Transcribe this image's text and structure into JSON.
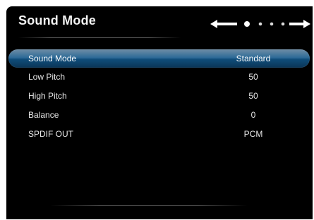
{
  "header": {
    "title": "Sound Mode"
  },
  "pager": {
    "left_icon": "arrow-left-icon",
    "right_icon": "arrow-right-icon",
    "dots": 4,
    "active_dot": 1
  },
  "menu": {
    "items": [
      {
        "label": "Sound Mode",
        "value": "Standard",
        "selected": true
      },
      {
        "label": "Low Pitch",
        "value": "50",
        "selected": false
      },
      {
        "label": "High Pitch",
        "value": "50",
        "selected": false
      },
      {
        "label": "Balance",
        "value": "0",
        "selected": false
      },
      {
        "label": "SPDIF OUT",
        "value": "PCM",
        "selected": false
      }
    ]
  },
  "colors": {
    "background": "#000000",
    "highlight": "#2d6a97",
    "text": "#e8e8e8"
  }
}
